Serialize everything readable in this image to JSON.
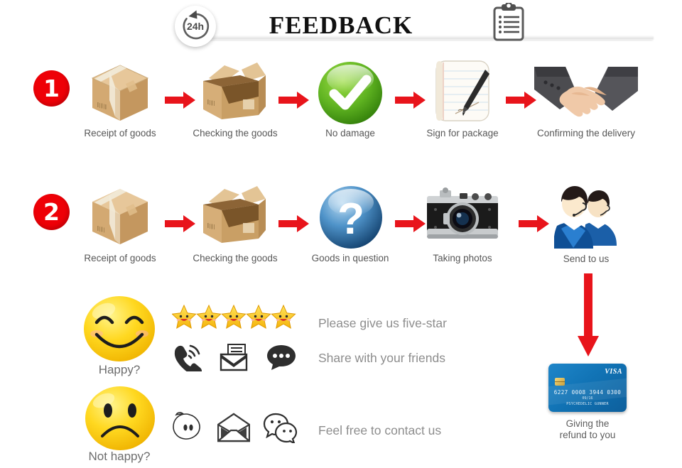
{
  "header": {
    "title": "FEEDBACK",
    "badge_label": "24h",
    "badge_icon": "refresh-24h-icon",
    "clipboard_icon": "clipboard-icon"
  },
  "flows": [
    {
      "number": "1",
      "steps": [
        {
          "label": "Receipt of goods",
          "icon": "closed-box-icon"
        },
        {
          "label": "Checking the goods",
          "icon": "open-box-icon"
        },
        {
          "label": "No damage",
          "icon": "green-check-icon"
        },
        {
          "label": "Sign for package",
          "icon": "signed-document-icon"
        },
        {
          "label": "Confirming the delivery",
          "icon": "handshake-icon"
        }
      ]
    },
    {
      "number": "2",
      "steps": [
        {
          "label": "Receipt of goods",
          "icon": "closed-box-icon"
        },
        {
          "label": "Checking the goods",
          "icon": "open-box-icon"
        },
        {
          "label": "Goods in question",
          "icon": "blue-question-icon"
        },
        {
          "label": "Taking photos",
          "icon": "camera-icon"
        },
        {
          "label": "Send to us",
          "icon": "support-agents-icon"
        }
      ]
    }
  ],
  "bottom": {
    "happy": {
      "caption": "Happy?",
      "face_icon": "smiling-face-icon",
      "rows": [
        {
          "text": "Please give us five-star",
          "icons": [
            "star-icon",
            "star-icon",
            "star-icon",
            "star-icon",
            "star-icon"
          ]
        },
        {
          "text": "Share with your friends",
          "icons": [
            "phone-ring-icon",
            "mail-icon",
            "chat-bubble-icon"
          ]
        }
      ]
    },
    "not_happy": {
      "caption": "Not happy?",
      "face_icon": "sad-face-icon",
      "rows": [
        {
          "text": "Feel free to contact us",
          "icons": [
            "qq-bubble-icon",
            "open-envelope-icon",
            "wechat-icon"
          ]
        }
      ]
    }
  },
  "refund": {
    "arrow_icon": "down-arrow-icon",
    "caption": "Giving the\nrefund to you",
    "caption_line1": "Giving the",
    "caption_line2": "refund to you",
    "card": {
      "brand": "VISA",
      "number": "6227 0008 3944 0300",
      "expiry": "09/16",
      "holder": "PSYCHEDELIC GUNNER"
    }
  },
  "colors": {
    "accent_red": "#ee0007",
    "arrow_red": "#e8141b",
    "label_gray": "#575757",
    "text_gray": "#8d8d8d",
    "card_blue": "#1173b5",
    "check_green": "#57a719",
    "question_blue": "#2f7fc1",
    "star_yellow": "#ffd21e",
    "box_tan": "#d6ab74"
  }
}
